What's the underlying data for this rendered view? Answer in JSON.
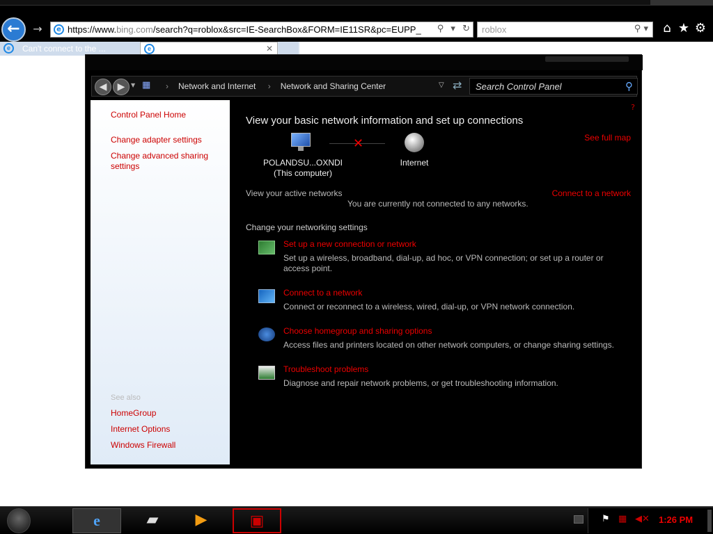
{
  "browser": {
    "url_main": "https://www.",
    "url_domain": "bing.com",
    "url_path": "/search?q=roblox&src=IE-SearchBox&FORM=IE11SR&pc=EUPP_",
    "search_value": "roblox",
    "tabs": [
      {
        "label": "Can't connect to the ..."
      },
      {
        "label": ""
      }
    ],
    "accent_color": "#2b7bd3"
  },
  "control_panel": {
    "breadcrumb": [
      "Network and Internet",
      "Network and Sharing Center"
    ],
    "search_placeholder": "Search Control Panel",
    "left": {
      "home": "Control Panel Home",
      "links": [
        "Change adapter settings",
        "Change advanced sharing settings"
      ],
      "see_also_header": "See also",
      "see_also": [
        "HomeGroup",
        "Internet Options",
        "Windows Firewall"
      ]
    },
    "main": {
      "title": "View your basic network information and set up connections",
      "see_full_map": "See full map",
      "computer_name": "POLANDSU...OXNDI",
      "computer_sub": "(This computer)",
      "internet_label": "Internet",
      "active_networks": "View your active networks",
      "connect_to_network": "Connect to a network",
      "not_connected": "You are currently not connected to any networks.",
      "change_settings": "Change your networking settings",
      "tasks": [
        {
          "title": "Set up a new connection or network",
          "desc": "Set up a wireless, broadband, dial-up, ad hoc, or VPN connection; or set up a router or access point."
        },
        {
          "title": "Connect to a network",
          "desc": "Connect or reconnect to a wireless, wired, dial-up, or VPN network connection."
        },
        {
          "title": "Choose homegroup and sharing options",
          "desc": "Access files and printers located on other network computers, or change sharing settings."
        },
        {
          "title": "Troubleshoot problems",
          "desc": "Diagnose and repair network problems, or get troubleshooting information."
        }
      ]
    },
    "link_color": "#e00000"
  },
  "taskbar": {
    "clock": "1:26 PM"
  }
}
